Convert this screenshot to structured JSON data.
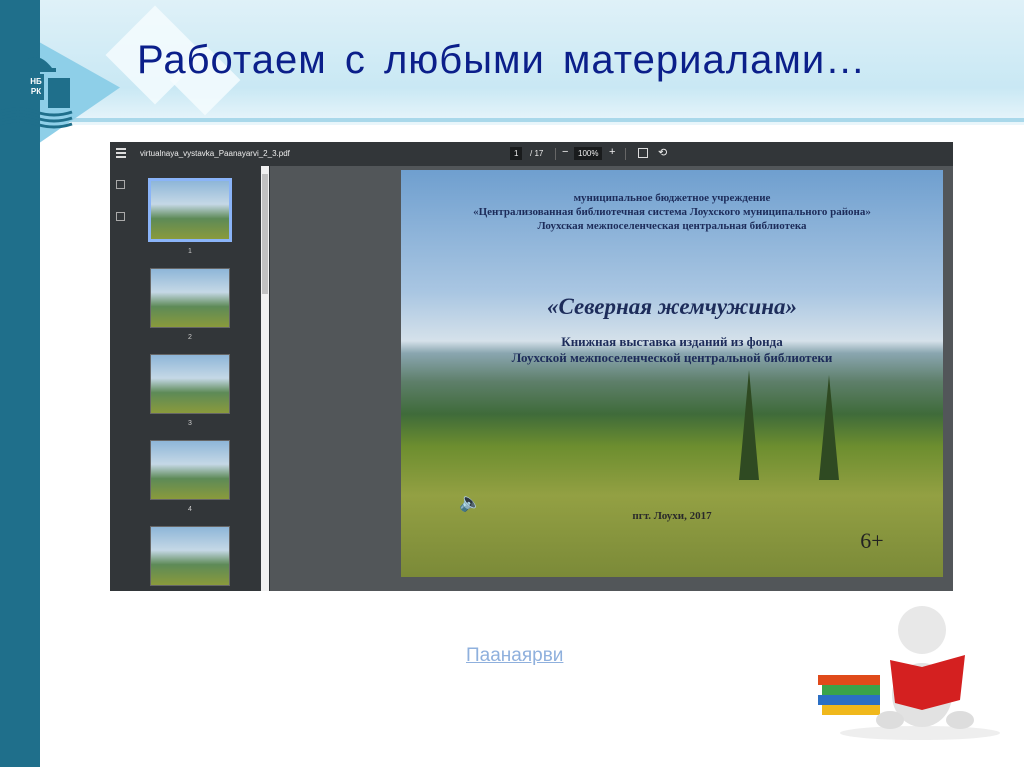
{
  "slide_title": "Работаем с любыми материалами…",
  "logo": {
    "text_top": "НБ",
    "text_bottom": "РК"
  },
  "viewer": {
    "filename": "virtualnaya_vystavka_Paanayarvi_2_3.pdf",
    "current_page": "1",
    "total_pages": "/ 17",
    "zoom": "100%",
    "zoom_out": "−",
    "zoom_in": "+",
    "thumbnails": [
      "1",
      "2",
      "3",
      "4"
    ]
  },
  "pdf_slide": {
    "line1": "муниципальное бюджетное учреждение",
    "line2": "«Централизованная библиотечная система Лоухского муниципального района»",
    "line3": "Лоухская межпоселенческая центральная библиотека",
    "headline": "«Северная жемчужина»",
    "sub1": "Книжная выставка изданий из фонда",
    "sub2": "Лоухской межпоселенческой центральной библиотеки",
    "place": "пгт. Лоухи, 2017",
    "age": "6+"
  },
  "link_text": "Паанаярви"
}
